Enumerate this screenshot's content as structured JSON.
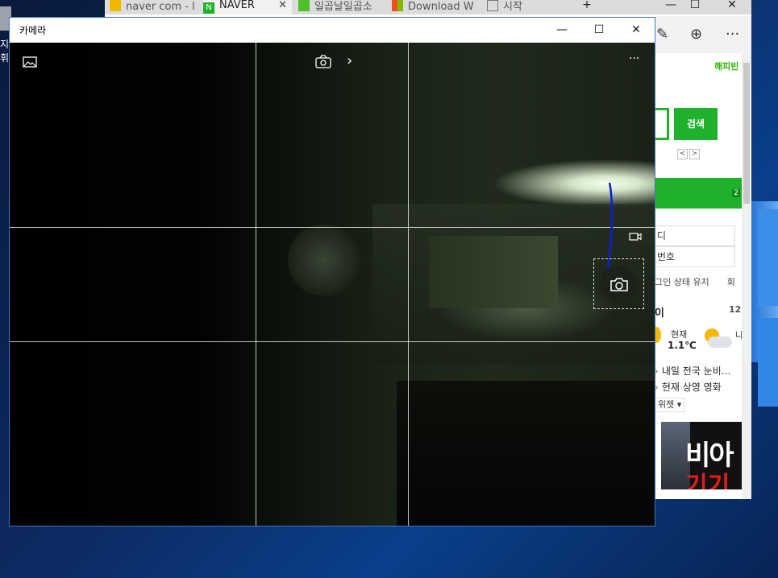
{
  "desktop": {
    "icon_label": "지휘"
  },
  "browser": {
    "tabs": [
      {
        "label": "naver com - l",
        "icon": "bing-icon",
        "active": false
      },
      {
        "label": "NAVER",
        "icon": "naver-icon",
        "active": true
      },
      {
        "label": "일곱날일곱소",
        "icon": "blog-icon",
        "active": false
      },
      {
        "label": "Download W",
        "icon": "windows-logo-icon",
        "active": false
      },
      {
        "label": "시작",
        "icon": "start-page-icon",
        "active": false
      }
    ],
    "new_tab": "+",
    "window_controls": {
      "minimize": "—",
      "maximize": "☐",
      "close": "✕"
    },
    "toolbar": {
      "notes": "✎",
      "share": "⊕",
      "more": "···"
    },
    "page": {
      "happybean": "해피빈",
      "search_button": "검색",
      "pager": [
        "<",
        ">"
      ],
      "greenbar_badge": "2",
      "login_id": "디",
      "login_pw": "번호",
      "keep_login": "그인 상태 유지",
      "keep_login_right": "회",
      "weather_title": "이",
      "weather_num": "12",
      "weather_label": "현재",
      "weather_temp": "1.1℃",
      "weather_right": "나",
      "news": [
        "내일 전국 눈비…",
        "현재 상영 영화"
      ],
      "news_right": [
        ":",
        "|"
      ],
      "widget": "위젯 ▾",
      "banner_line1": "비아",
      "banner_line2": "기기"
    }
  },
  "camera": {
    "title": "카메라",
    "controls": {
      "minimize": "—",
      "maximize": "☐",
      "close": "✕"
    },
    "toolbar": {
      "gallery": "gallery-icon",
      "switch_camera": "switch-camera-icon",
      "chevron": "›",
      "more": "···"
    },
    "grid": {
      "vertical_thirds": 2,
      "horizontal_thirds": 2
    },
    "mode": "photo"
  },
  "colors": {
    "naver_green": "#1fb12c",
    "camera_border": "#3a74c4",
    "desktop_blue": "#0d2a63"
  }
}
